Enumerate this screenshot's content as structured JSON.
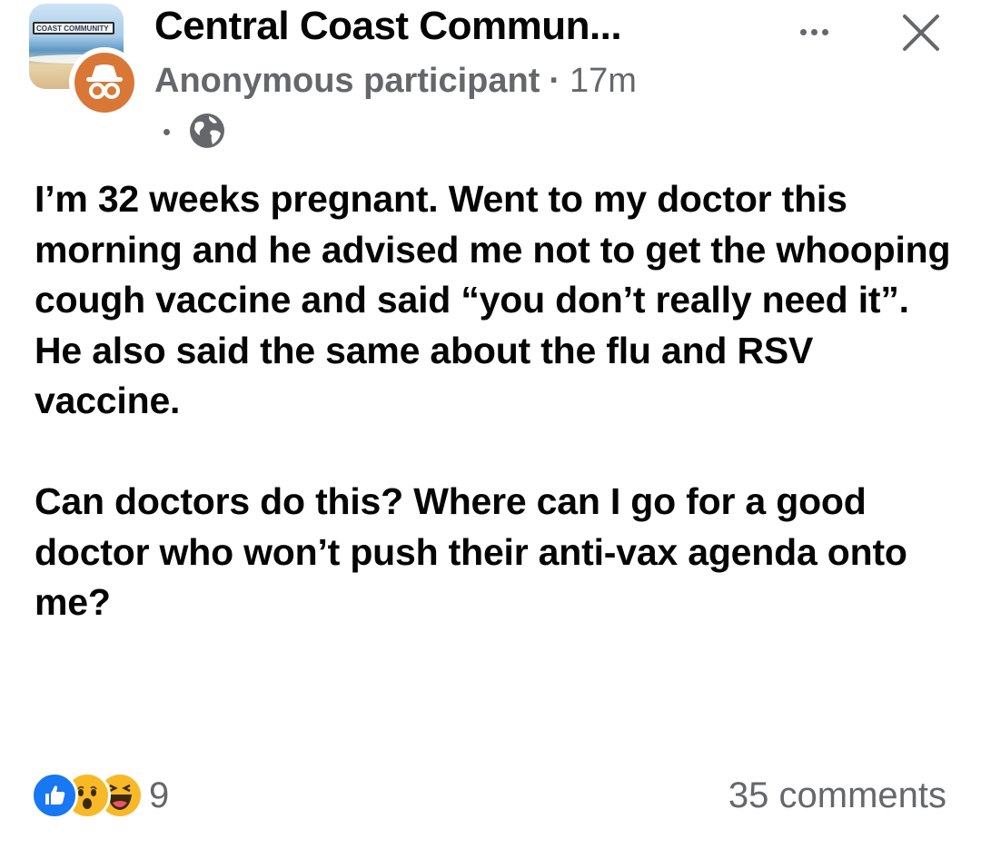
{
  "header": {
    "group_name": "Central Coast Commun...",
    "avatar_banner_text": "COAST COMMUNITY",
    "author": "Anonymous participant",
    "separator": "·",
    "time": "17m",
    "privacy_icon": "globe-icon",
    "more_icon": "more-horizontal-icon",
    "close_icon": "close-icon"
  },
  "post": {
    "paragraphs": [
      "I’m 32 weeks pregnant. Went to my doctor this morning and he advised me not to get the whooping cough vaccine and said “you don’t really need it”. He also said the same about the flu and RSV vaccine.",
      "Can doctors do this? Where can I go for a good doctor who won’t push their anti-vax agenda onto me?"
    ]
  },
  "footer": {
    "reactions": [
      "like",
      "wow",
      "haha"
    ],
    "reaction_count": "9",
    "comments": "35 comments"
  },
  "colors": {
    "like_blue": "#1877f2",
    "emoji_yellow": "#f7b928",
    "secondary_text": "#65676b",
    "anon_orange": "#d97736"
  }
}
